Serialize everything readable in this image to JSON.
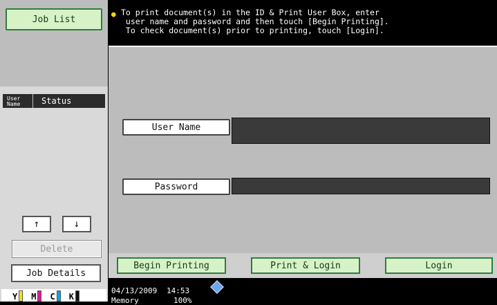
{
  "sidebar": {
    "job_list_label": "Job List",
    "columns": {
      "user_name": "User\nName",
      "status": "Status"
    },
    "up_arrow": "↑",
    "down_arrow": "↓",
    "delete_label": "Delete",
    "job_details_label": "Job Details",
    "toner": [
      {
        "label": "Y",
        "color": "#f2e600"
      },
      {
        "label": "M",
        "color": "#e01890"
      },
      {
        "label": "C",
        "color": "#00a6e6"
      },
      {
        "label": "K",
        "color": "#111111"
      }
    ]
  },
  "message": {
    "icon": "info-bulb-icon",
    "lines": [
      "To print document(s) in the ID & Print User Box, enter",
      " user name and password and then touch [Begin Printing].",
      " To check document(s) prior to printing, touch [Login]."
    ]
  },
  "form": {
    "user_name_label": "User Name",
    "user_name_value": "",
    "password_label": "Password",
    "password_value": ""
  },
  "actions": {
    "begin_printing": "Begin Printing",
    "print_login": "Print & Login",
    "login": "Login"
  },
  "status_bar": {
    "date": "04/13/2009",
    "time": "14:53",
    "memory_label": "Memory",
    "memory_value": "100%"
  }
}
